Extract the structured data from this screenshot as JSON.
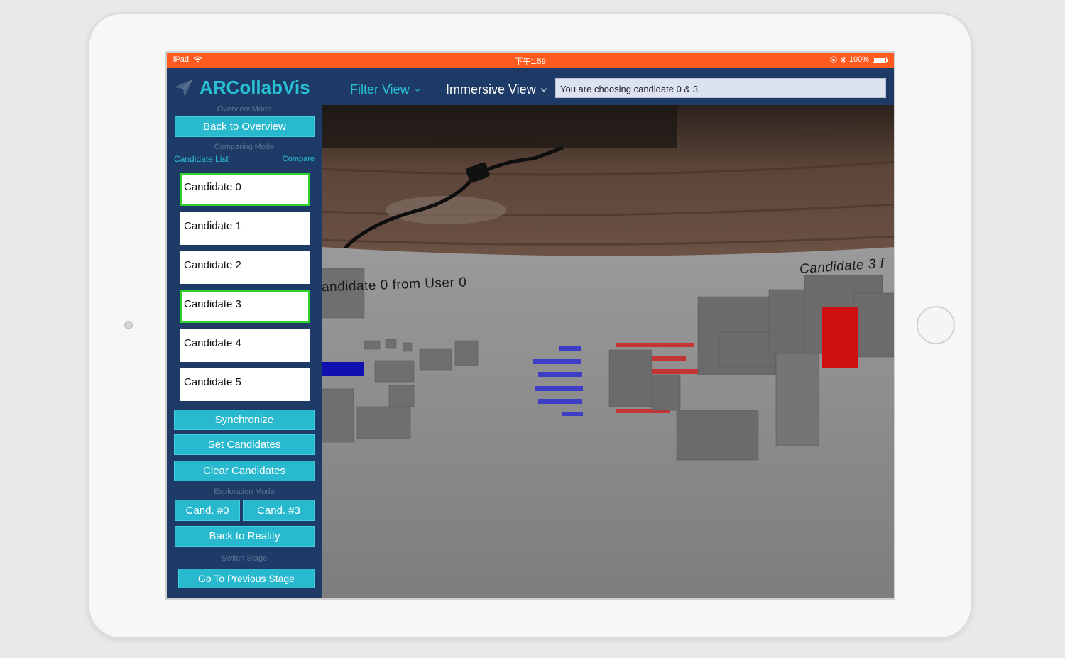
{
  "status_bar": {
    "device": "iPad",
    "time": "下午1:59",
    "battery": "100%"
  },
  "header": {
    "app_title": "ARCollabVis",
    "filter_view": "Filter View",
    "immersive_view": "Immersive View",
    "status_message": "You are choosing candidate 0 & 3"
  },
  "sidebar": {
    "overview_mode_label": "Overview Mode",
    "back_to_overview": "Back to Overview",
    "comparing_mode_label": "Comparing Mode",
    "candidate_list_label": "Candidate List",
    "compare_link": "Compare",
    "candidates": [
      {
        "label": "Candidate 0",
        "selected": true
      },
      {
        "label": "Candidate 1",
        "selected": false
      },
      {
        "label": "Candidate 2",
        "selected": false
      },
      {
        "label": "Candidate 3",
        "selected": true
      },
      {
        "label": "Candidate 4",
        "selected": false
      },
      {
        "label": "Candidate 5",
        "selected": false
      }
    ],
    "synchronize": "Synchronize",
    "set_candidates": "Set Candidates",
    "clear_candidates": "Clear Candidates",
    "exploration_mode_label": "Exploration Mode",
    "cand_0": "Cand. #0",
    "cand_3": "Cand. #3",
    "back_to_reality": "Back to Reality",
    "switch_stage_label": "Switch Stage",
    "go_previous_stage": "Go To Previous Stage"
  },
  "ar_scene": {
    "left_label": "andidate 0 from User 0",
    "right_label": "Candidate 3 f",
    "colors": {
      "candidate_0_highlight": "#1010b0",
      "candidate_3_highlight": "#d01010",
      "surface": "#8a8a8a"
    }
  },
  "colors": {
    "accent": "#28b9cf",
    "navbar": "#1e3a66",
    "status_bar": "#ff5a1f",
    "selected_border": "#2ed22e"
  }
}
